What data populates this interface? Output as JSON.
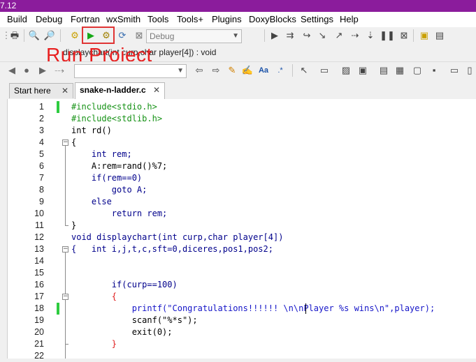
{
  "window": {
    "title": "7.12",
    "accent": "#8b1c9c"
  },
  "menu": {
    "items": [
      "Build",
      "Debug",
      "Fortran",
      "wxSmith",
      "Tools",
      "Tools+",
      "Plugins",
      "DoxyBlocks",
      "Settings",
      "Help"
    ]
  },
  "toolbar": {
    "build_target": "Debug",
    "annotation": "Run Project",
    "function_signature": "displaychart(int curp,char player[4]) : void"
  },
  "tabs": [
    {
      "label": "Start here",
      "active": false
    },
    {
      "label": "snake-n-ladder.c",
      "active": true
    }
  ],
  "editor": {
    "lines": [
      {
        "n": "1",
        "text": "#include<stdio.h>"
      },
      {
        "n": "2",
        "text": "#include<stdlib.h>"
      },
      {
        "n": "3",
        "text": "int rd()"
      },
      {
        "n": "4",
        "text": "{"
      },
      {
        "n": "5",
        "text": "    int rem;"
      },
      {
        "n": "6",
        "text": "    A:rem=rand()%7;"
      },
      {
        "n": "7",
        "text": "    if(rem==0)"
      },
      {
        "n": "8",
        "text": "        goto A;"
      },
      {
        "n": "9",
        "text": "    else"
      },
      {
        "n": "10",
        "text": "        return rem;"
      },
      {
        "n": "11",
        "text": "}"
      },
      {
        "n": "12",
        "text": "void displaychart(int curp,char player[4])"
      },
      {
        "n": "13",
        "text": "{   int i,j,t,c,sft=0,diceres,pos1,pos2;"
      },
      {
        "n": "14",
        "text": ""
      },
      {
        "n": "15",
        "text": ""
      },
      {
        "n": "16",
        "text": "        if(curp==100)"
      },
      {
        "n": "17",
        "text": "        {"
      },
      {
        "n": "18",
        "text": "            printf(\"Congratulations!!!!!! \\n\\nPlayer %s wins\\n\",player);"
      },
      {
        "n": "19",
        "text": "            scanf(\"%*s\");"
      },
      {
        "n": "20",
        "text": "            exit(0);"
      },
      {
        "n": "21",
        "text": "        }"
      },
      {
        "n": "22",
        "text": ""
      }
    ]
  }
}
